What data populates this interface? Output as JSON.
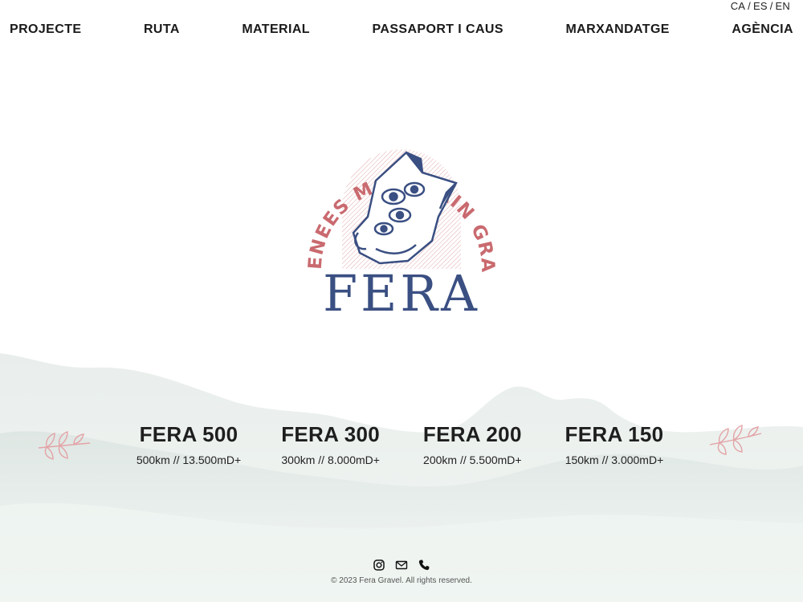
{
  "languages": [
    "CA",
    "ES",
    "EN"
  ],
  "nav": [
    "PROJECTE",
    "RUTA",
    "MATERIAL",
    "PASSAPORT I CAUS",
    "MARXANDATGE",
    "AGÈNCIA"
  ],
  "logo": {
    "arc_text": "PYRENEES MOUNTAIN GRAVEL",
    "title": "FERA"
  },
  "routes": [
    {
      "name": "FERA 500",
      "stats": "500km // 13.500mD+"
    },
    {
      "name": "FERA 300",
      "stats": "300km // 8.000mD+"
    },
    {
      "name": "FERA 200",
      "stats": "200km // 5.500mD+"
    },
    {
      "name": "FERA 150",
      "stats": "150km // 3.000mD+"
    }
  ],
  "footer": {
    "icons": [
      "instagram-icon",
      "mail-icon",
      "phone-icon"
    ],
    "copyright": "© 2023 Fera Gravel. All rights reserved."
  },
  "colors": {
    "logo_blue": "#3a4f82",
    "logo_red": "#c96a6f",
    "mountain": "#dfe6e4"
  }
}
